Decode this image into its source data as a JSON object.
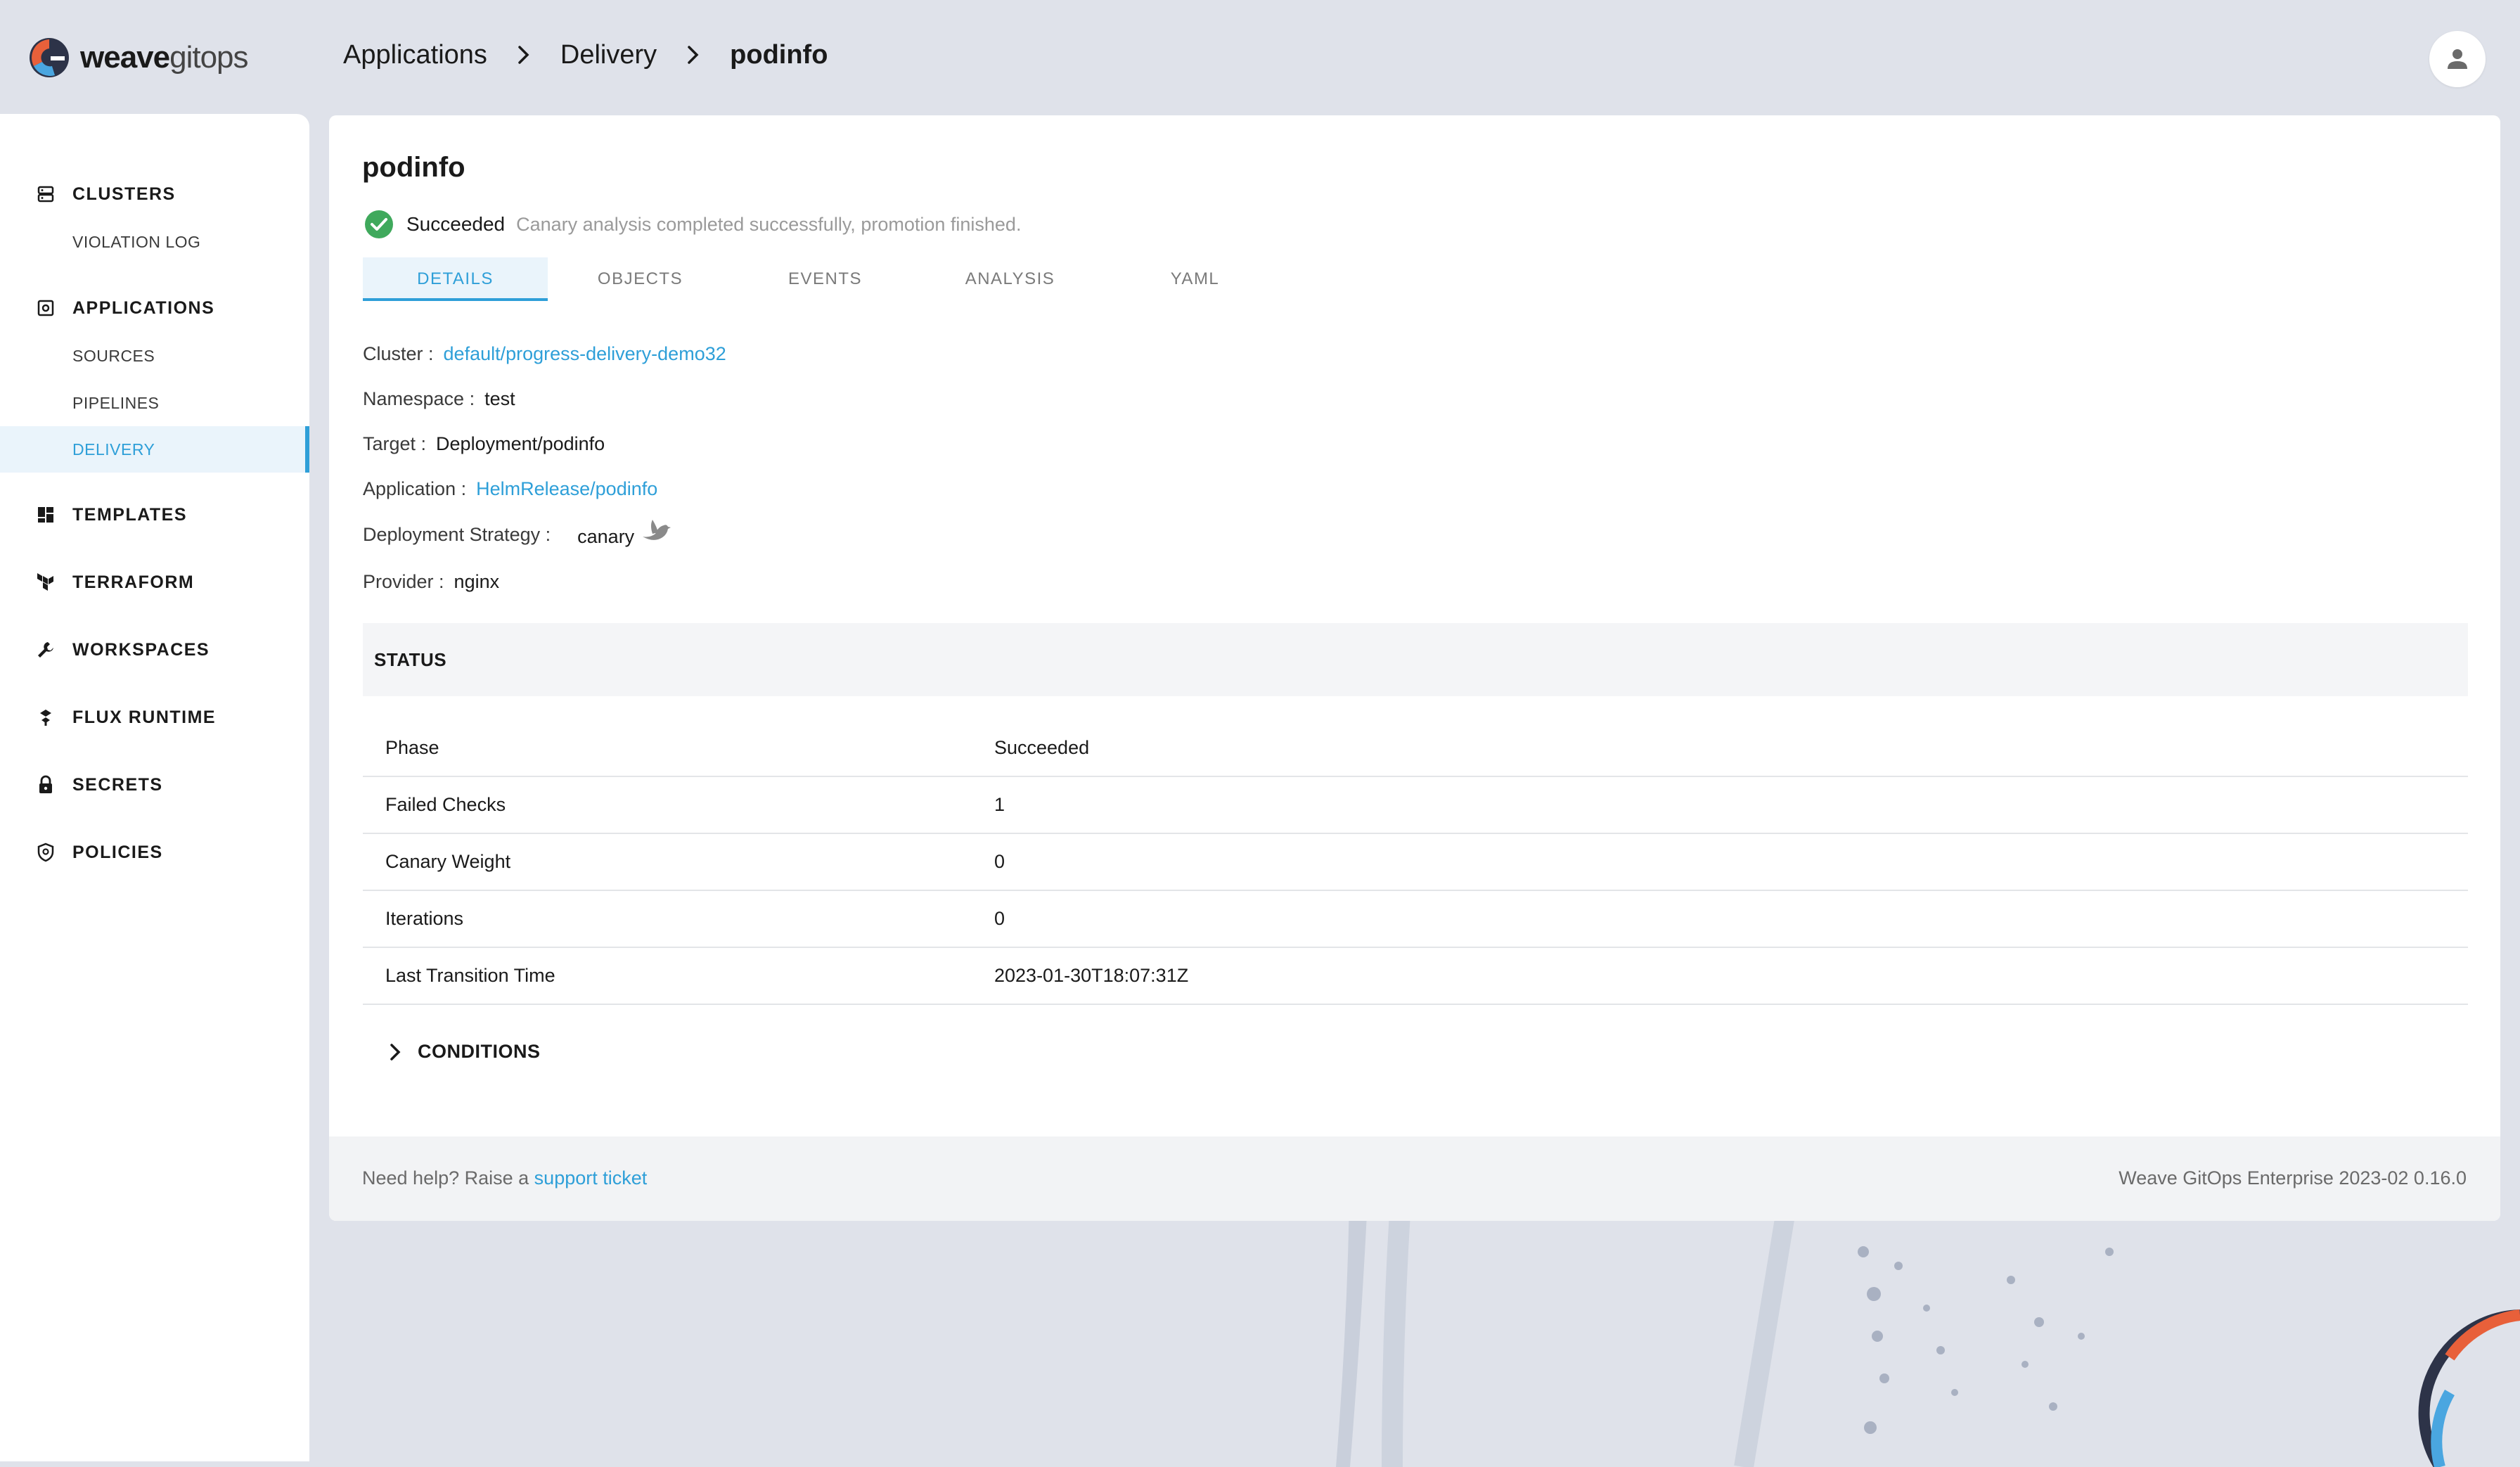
{
  "app": {
    "logo_bold": "weave",
    "logo_light": "gitops"
  },
  "breadcrumb": [
    "Applications",
    "Delivery",
    "podinfo"
  ],
  "sidebar": {
    "clusters": "CLUSTERS",
    "violation_log": "VIOLATION LOG",
    "applications": "APPLICATIONS",
    "sources": "SOURCES",
    "pipelines": "PIPELINES",
    "delivery": "DELIVERY",
    "templates": "TEMPLATES",
    "terraform": "TERRAFORM",
    "workspaces": "WORKSPACES",
    "flux_runtime": "FLUX RUNTIME",
    "secrets": "SECRETS",
    "policies": "POLICIES"
  },
  "page": {
    "title": "podinfo",
    "status": "Succeeded",
    "status_message": "Canary analysis completed successfully, promotion finished."
  },
  "tabs": [
    "DETAILS",
    "OBJECTS",
    "EVENTS",
    "ANALYSIS",
    "YAML"
  ],
  "details": {
    "cluster_label": "Cluster :",
    "cluster_value": "default/progress-delivery-demo32",
    "namespace_label": "Namespace :",
    "namespace_value": "test",
    "target_label": "Target :",
    "target_value": "Deployment/podinfo",
    "application_label": "Application :",
    "application_value": "HelmRelease/podinfo",
    "strategy_label": "Deployment Strategy :",
    "strategy_value": "canary",
    "provider_label": "Provider :",
    "provider_value": "nginx"
  },
  "status_section": {
    "heading": "STATUS",
    "rows": [
      {
        "key": "Phase",
        "value": "Succeeded"
      },
      {
        "key": "Failed Checks",
        "value": "1"
      },
      {
        "key": "Canary Weight",
        "value": "0"
      },
      {
        "key": "Iterations",
        "value": "0"
      },
      {
        "key": "Last Transition Time",
        "value": "2023-01-30T18:07:31Z"
      }
    ]
  },
  "conditions_label": "CONDITIONS",
  "footer": {
    "help_text": "Need help? Raise a ",
    "help_link": "support ticket",
    "version": "Weave GitOps Enterprise 2023-02 0.16.0"
  },
  "colors": {
    "accent": "#2e9fd8",
    "success": "#3fa95c",
    "background": "#dfe2ea"
  },
  "icons": [
    "weave-logo-icon",
    "chevron-right-icon",
    "user-icon",
    "clusters-icon",
    "applications-icon",
    "templates-icon",
    "terraform-icon",
    "workspaces-icon",
    "flux-icon",
    "secrets-icon",
    "policies-icon",
    "check-circle-icon",
    "canary-bird-icon"
  ]
}
